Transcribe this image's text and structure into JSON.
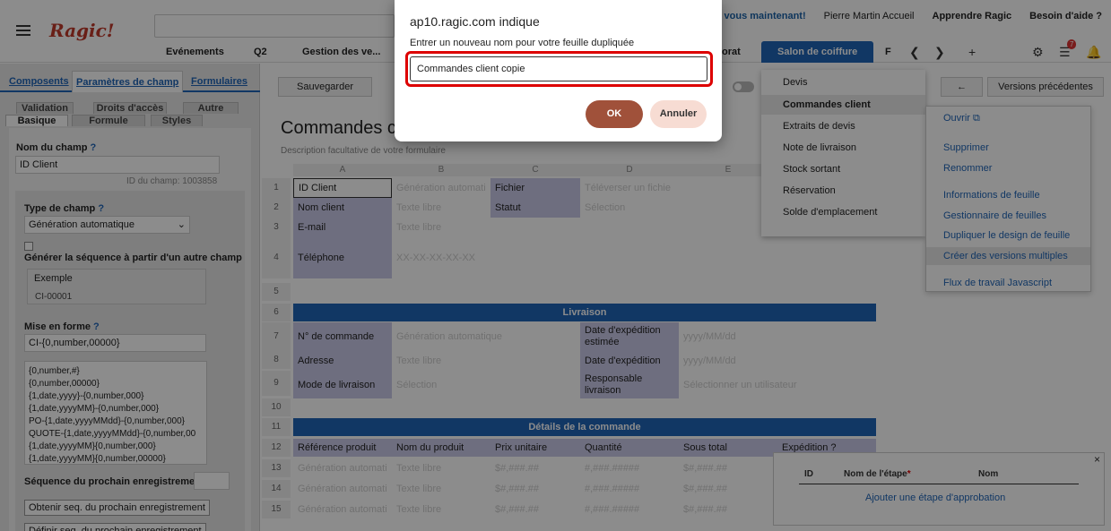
{
  "header": {
    "logo": "Ragic!",
    "links": [
      "vous maintenant!",
      "Pierre Martin Accueil",
      "Apprendre Ragic",
      "Besoin d'aide ?"
    ],
    "tabs": [
      "Evénements",
      "Q2",
      "Gestion des ve...",
      "orat",
      "Salon de coiffure",
      "F"
    ],
    "notif_count": "7"
  },
  "left": {
    "tabs": [
      "Composents",
      "Paramètres de champ",
      "Formulaires"
    ],
    "subtabs_row1": [
      "Validation",
      "Droits d'accès",
      "Autre"
    ],
    "subtabs_row2": [
      "Basique",
      "Formule",
      "Styles"
    ],
    "field_name_label": "Nom du champ",
    "field_name_value": "ID Client",
    "field_id": "ID du champ: 1003858",
    "field_type_label": "Type de champ",
    "field_type_value": "Génération automatique",
    "generate_label": "Générer la séquence à partir d'un autre champ",
    "example_label": "Exemple",
    "example_value": "CI-00001",
    "format_label": "Mise en forme",
    "format_value": "CI-{0,number,00000}",
    "format_options": [
      "{0,number,#}",
      "{0,number,00000}",
      "{1,date,yyyy}-{0,number,000}",
      "{1,date,yyyyMM}-{0,number,000}",
      "PO-{1,date,yyyyMMdd}-{0,number,000}",
      "QUOTE-{1,date,yyyyMMdd}-{0,number,00",
      "{1,date,yyyyMM}{0,number,000}",
      "{1,date,yyyyMM}{0,number,00000}"
    ],
    "next_seq_label": "Séquence du prochain enregistrement",
    "get_next_button": "Obtenir seq. du prochain enregistrement",
    "define_next_button": "Définir seq. du prochain enregistrement"
  },
  "center": {
    "save_button": "Sauvegarder",
    "form_title": "Commandes c",
    "form_desc": "Description facultative de votre formulaire",
    "columns": [
      "A",
      "B",
      "C",
      "D",
      "E"
    ],
    "rows": [
      "1",
      "2",
      "3",
      "4",
      "5",
      "6",
      "7",
      "8",
      "9",
      "10",
      "11",
      "12",
      "13",
      "14",
      "15"
    ],
    "cells": {
      "r1_a": "ID Client",
      "r1_b": "Génération automati",
      "r1_c": "Fichier",
      "r1_d": "Téléverser un fichie",
      "r2_a": "Nom client",
      "r2_b": "Texte libre",
      "r2_c": "Statut",
      "r2_d": "Sélection",
      "r3_a": "E-mail",
      "r3_b": "Texte libre",
      "r4_a": "Téléphone",
      "r4_b": "XX-XX-XX-XX-XX",
      "livraison": "Livraison",
      "r7_a": "N° de commande",
      "r7_b": "Génération automatique",
      "r7_c": "Date d'expédition estimée",
      "r7_d": "yyyy/MM/dd",
      "r8_a": "Adresse",
      "r8_b": "Texte libre",
      "r8_c": "Date d'expédition",
      "r8_d": "yyyy/MM/dd",
      "r9_a": "Mode de livraison",
      "r9_b": "Sélection",
      "r9_c": "Responsable livraison",
      "r9_d": "Sélectionner un utilisateur",
      "details": "Détails de la commande",
      "r12": [
        "Référence produit",
        "Nom du produit",
        "Prix unitaire",
        "Quantité",
        "Sous total",
        "Expédition ?"
      ],
      "r13": [
        "Génération automati",
        "Texte libre",
        "$#,###.##",
        "#,###.#####",
        "$#,###.##"
      ],
      "r14": [
        "Génération automati",
        "Texte libre",
        "$#,###.##",
        "#,###.#####",
        "$#,###.##"
      ],
      "r15": [
        "Génération automati",
        "Texte libre",
        "$#,###.##",
        "#,###.#####",
        "$#,###.##"
      ]
    }
  },
  "sheet_menu": {
    "items": [
      "Devis",
      "Commandes client",
      "Extraits de devis",
      "Note de livraison",
      "Stock sortant",
      "Réservation",
      "Solde d'emplacement"
    ],
    "selected": "Commandes client"
  },
  "right": {
    "back_label": "←",
    "versions_button": "Versions précédentes",
    "menu": [
      "Ouvrir",
      "Supprimer",
      "Renommer",
      "Informations de feuille",
      "Gestionnaire de feuilles",
      "Dupliquer le design de feuille",
      "Créer des versions multiples",
      "Flux de travail Javascript"
    ]
  },
  "approval": {
    "columns": [
      "ID",
      "Nom de l'étape",
      "Nom"
    ],
    "required_mark": "*",
    "add_link": "Ajouter une étape d'approbation",
    "close": "×"
  },
  "dialog": {
    "title": "ap10.ragic.com indique",
    "message": "Entrer un nouveau nom pour votre feuille dupliquée",
    "input_value": "Commandes client copie",
    "ok": "OK",
    "cancel": "Annuler"
  }
}
